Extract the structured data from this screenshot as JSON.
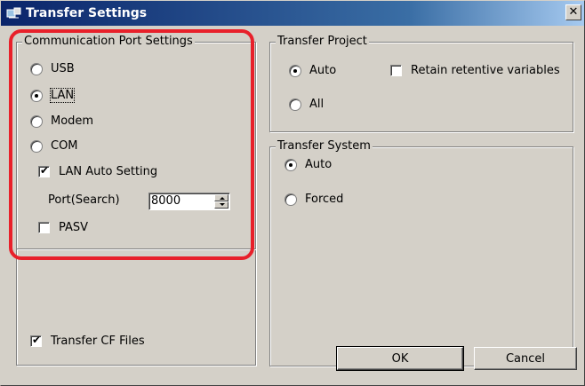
{
  "window": {
    "title": "Transfer Settings",
    "close_glyph": "✕"
  },
  "comm_port": {
    "legend": "Communication Port Settings",
    "options": [
      {
        "label": "USB",
        "selected": false
      },
      {
        "label": "LAN",
        "selected": true
      },
      {
        "label": "Modem",
        "selected": false
      },
      {
        "label": "COM",
        "selected": false
      }
    ],
    "lan_auto_setting": {
      "label": "LAN Auto Setting",
      "checked": true
    },
    "port_search": {
      "label": "Port(Search)",
      "value": "8000"
    },
    "pasv": {
      "label": "PASV",
      "checked": false
    }
  },
  "transfer_cf_files": {
    "label": "Transfer CF Files",
    "checked": true
  },
  "transfer_project": {
    "legend": "Transfer Project",
    "options": [
      {
        "label": "Auto",
        "selected": true
      },
      {
        "label": "All",
        "selected": false
      }
    ],
    "retain_retentive": {
      "label": "Retain retentive variables",
      "checked": false
    }
  },
  "transfer_system": {
    "legend": "Transfer System",
    "options": [
      {
        "label": "Auto",
        "selected": true
      },
      {
        "label": "Forced",
        "selected": false
      }
    ]
  },
  "buttons": {
    "ok": "OK",
    "cancel": "Cancel"
  },
  "colors": {
    "highlight": "#e8202a",
    "titlebar": "#0a246a",
    "dialog_bg": "#d4d0c8"
  }
}
